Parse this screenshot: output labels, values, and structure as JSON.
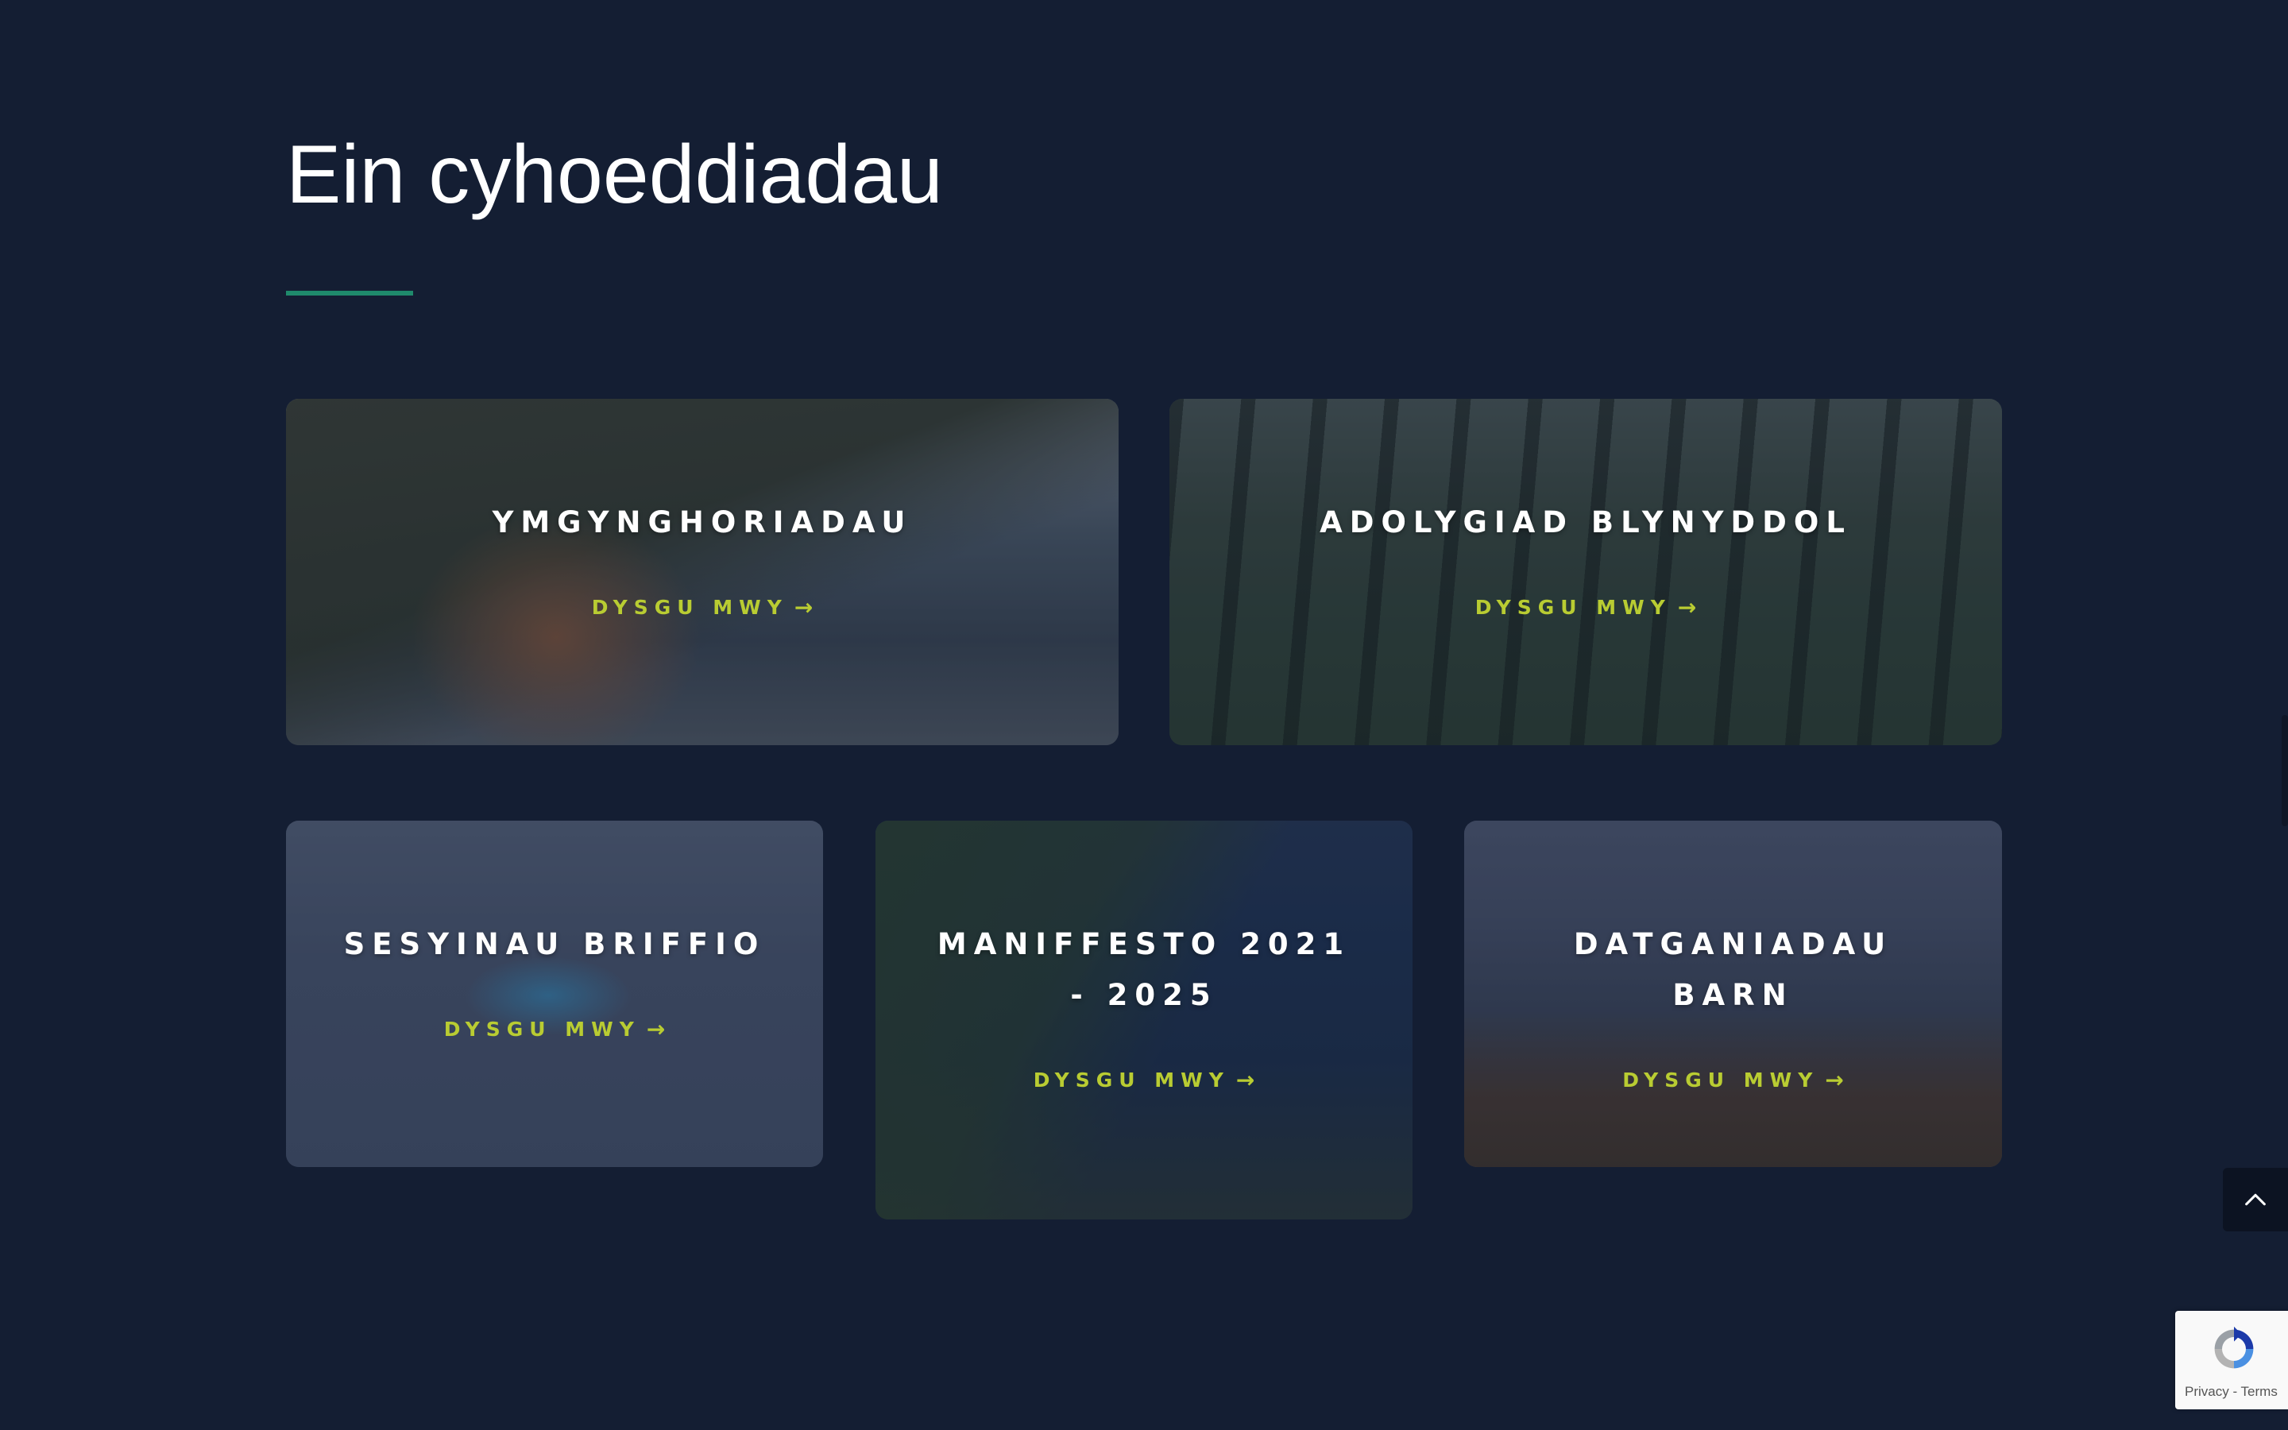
{
  "section": {
    "title": "Ein cyhoeddiadau"
  },
  "cards": [
    {
      "title": "YMGYNGHORIADAU",
      "link_label": "DYSGU MWY",
      "arrow": "→"
    },
    {
      "title": "ADOLYGIAD BLYNYDDOL",
      "link_label": "DYSGU MWY",
      "arrow": "→"
    },
    {
      "title": "SESYINAU BRIFFIO",
      "link_label": "DYSGU MWY",
      "arrow": "→"
    },
    {
      "title": "MANIFFESTO 2021 - 2025",
      "link_label": "DYSGU MWY",
      "arrow": "→"
    },
    {
      "title": "DATGANIADAU BARN",
      "link_label": "DYSGU MWY",
      "arrow": "→"
    }
  ],
  "recaptcha": {
    "privacy_label": "Privacy",
    "separator": " - ",
    "terms_label": "Terms"
  },
  "icons": {
    "back_to_top": "chevron-up-icon",
    "recaptcha": "recaptcha-logo-icon"
  },
  "colors": {
    "background": "#141e33",
    "accent_underline": "#1f8a6c",
    "link": "#b9cc32",
    "title_text": "#ffffff"
  }
}
